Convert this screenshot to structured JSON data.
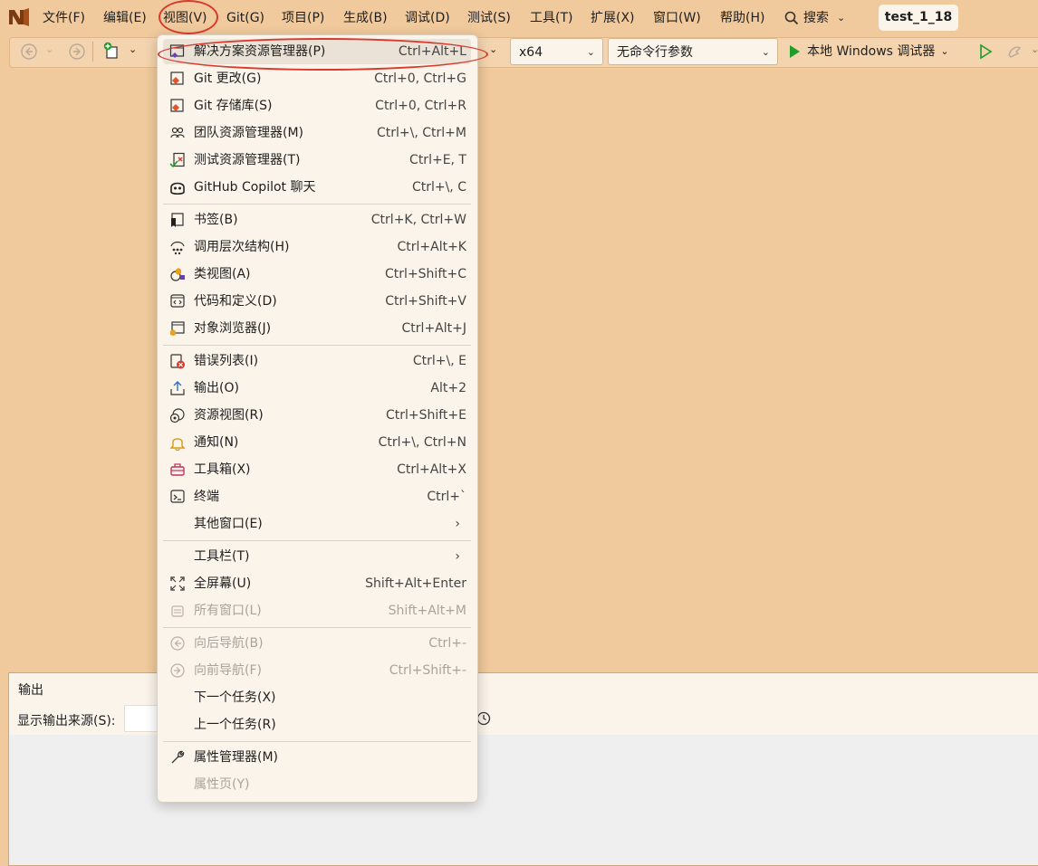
{
  "menubar": {
    "items": [
      "文件(F)",
      "编辑(E)",
      "视图(V)",
      "Git(G)",
      "项目(P)",
      "生成(B)",
      "调试(D)",
      "测试(S)",
      "工具(T)",
      "扩展(X)",
      "窗口(W)",
      "帮助(H)"
    ],
    "search_label": "搜索",
    "solution_title": "test_1_18"
  },
  "toolbar": {
    "platform": "x64",
    "args": "无命令行参数",
    "run_label": "本地 Windows 调试器"
  },
  "output_panel": {
    "title": "输出",
    "source_label": "显示输出来源(S):"
  },
  "view_menu": {
    "items": [
      {
        "label": "解决方案资源管理器(P)",
        "shortcut": "Ctrl+Alt+L",
        "icon": "solution-explorer-icon"
      },
      {
        "label": "Git 更改(G)",
        "shortcut": "Ctrl+0, Ctrl+G",
        "icon": "git-changes-icon"
      },
      {
        "label": "Git 存储库(S)",
        "shortcut": "Ctrl+0, Ctrl+R",
        "icon": "git-repository-icon"
      },
      {
        "label": "团队资源管理器(M)",
        "shortcut": "Ctrl+\\, Ctrl+M",
        "icon": "team-explorer-icon"
      },
      {
        "label": "测试资源管理器(T)",
        "shortcut": "Ctrl+E, T",
        "icon": "test-explorer-icon"
      },
      {
        "label": "GitHub Copilot 聊天",
        "shortcut": "Ctrl+\\, C",
        "icon": "copilot-icon"
      },
      {
        "label": "书签(B)",
        "shortcut": "Ctrl+K, Ctrl+W",
        "icon": "bookmark-icon"
      },
      {
        "label": "调用层次结构(H)",
        "shortcut": "Ctrl+Alt+K",
        "icon": "call-hierarchy-icon"
      },
      {
        "label": "类视图(A)",
        "shortcut": "Ctrl+Shift+C",
        "icon": "class-view-icon"
      },
      {
        "label": "代码和定义(D)",
        "shortcut": "Ctrl+Shift+V",
        "icon": "code-definition-icon"
      },
      {
        "label": "对象浏览器(J)",
        "shortcut": "Ctrl+Alt+J",
        "icon": "object-browser-icon"
      },
      {
        "label": "错误列表(I)",
        "shortcut": "Ctrl+\\, E",
        "icon": "error-list-icon"
      },
      {
        "label": "输出(O)",
        "shortcut": "Alt+2",
        "icon": "output-icon"
      },
      {
        "label": "资源视图(R)",
        "shortcut": "Ctrl+Shift+E",
        "icon": "resource-view-icon"
      },
      {
        "label": "通知(N)",
        "shortcut": "Ctrl+\\, Ctrl+N",
        "icon": "bell-icon"
      },
      {
        "label": "工具箱(X)",
        "shortcut": "Ctrl+Alt+X",
        "icon": "toolbox-icon"
      },
      {
        "label": "终端",
        "shortcut": "Ctrl+`",
        "icon": "terminal-icon"
      },
      {
        "label": "其他窗口(E)",
        "shortcut": "",
        "icon": ""
      },
      {
        "label": "工具栏(T)",
        "shortcut": "",
        "icon": ""
      },
      {
        "label": "全屏幕(U)",
        "shortcut": "Shift+Alt+Enter",
        "icon": "fullscreen-icon"
      },
      {
        "label": "所有窗口(L)",
        "shortcut": "Shift+Alt+M",
        "icon": "all-windows-icon"
      },
      {
        "label": "向后导航(B)",
        "shortcut": "Ctrl+-",
        "icon": "navigate-back-icon"
      },
      {
        "label": "向前导航(F)",
        "shortcut": "Ctrl+Shift+-",
        "icon": "navigate-forward-icon"
      },
      {
        "label": "下一个任务(X)",
        "shortcut": "",
        "icon": ""
      },
      {
        "label": "上一个任务(R)",
        "shortcut": "",
        "icon": ""
      },
      {
        "label": "属性管理器(M)",
        "shortcut": "",
        "icon": "wrench-icon"
      },
      {
        "label": "属性页(Y)",
        "shortcut": "",
        "icon": ""
      }
    ]
  },
  "colors": {
    "background": "#f0c99c",
    "menu_bg": "#fbf4ea",
    "highlight": "#d83a2e",
    "run_green": "#1f9d2b"
  }
}
